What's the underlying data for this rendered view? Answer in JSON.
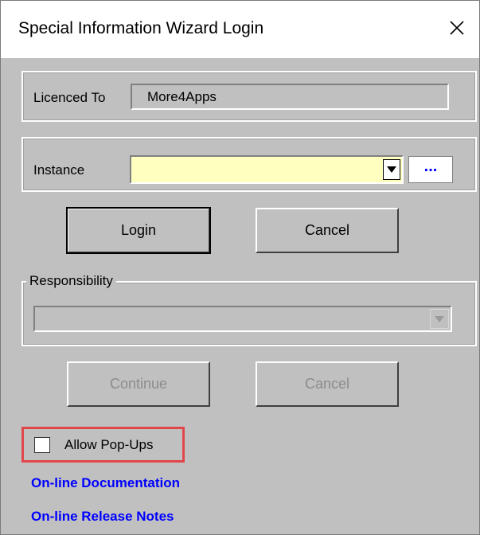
{
  "window": {
    "title": "Special Information Wizard Login"
  },
  "licence": {
    "label": "Licenced To",
    "value": "More4Apps"
  },
  "instance": {
    "label": "Instance",
    "value": "",
    "field_color": "#ffffc0",
    "browse_label": "..."
  },
  "login_buttons": {
    "login_label": "Login",
    "cancel_label": "Cancel"
  },
  "responsibility": {
    "legend": "Responsibility",
    "value": ""
  },
  "continue_buttons": {
    "continue_label": "Continue",
    "cancel_label": "Cancel"
  },
  "popups": {
    "label": "Allow Pop-Ups",
    "checked": false,
    "highlight_color": "#e0464a"
  },
  "links": {
    "documentation": "On-line Documentation",
    "release_notes": "On-line Release Notes",
    "link_color": "#0000ff"
  }
}
